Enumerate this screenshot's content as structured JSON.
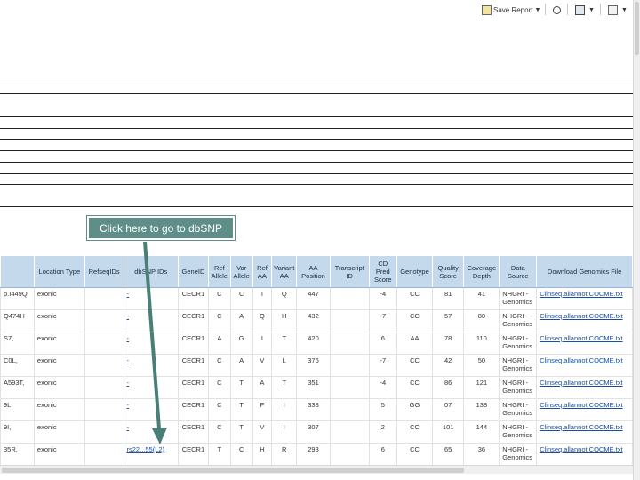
{
  "toolbar": {
    "save_report_label": "Save Report",
    "save_report_icon": "save-report-icon",
    "refresh_icon": "refresh-icon",
    "layout_icon": "layout-icon",
    "tools_icon": "tools-icon"
  },
  "callout": {
    "text": "Click here to go to dbSNP",
    "color": "#5f8e88"
  },
  "grid": {
    "header_color": "#c5d9ec",
    "link_color": "#1a4ea3",
    "columns": [
      "",
      "Location Type",
      "RefseqIDs",
      "dbSNP IDs",
      "GeneID",
      "Ref Allele",
      "Var Allele",
      "Ref AA",
      "Variant AA",
      "AA Position",
      "Transcript ID",
      "CD Pred Score",
      "Genotype",
      "Quality Score",
      "Coverage Depth",
      "Data Source",
      "Download Genomics File"
    ],
    "rows": [
      [
        "p.I449Q,",
        "exonic",
        "",
        "-",
        "CECR1",
        "C",
        "C",
        "I",
        "Q",
        "447",
        "",
        "-4",
        "CC",
        "81",
        "41",
        "NHGRI - Genomics",
        "Clinseq.allannot.COCME.txt"
      ],
      [
        "Q474H",
        "exonic",
        "",
        "-",
        "CECR1",
        "C",
        "A",
        "Q",
        "H",
        "432",
        "",
        "-7",
        "CC",
        "57",
        "80",
        "NHGRI - Genomics",
        "Clinseq.allannot.COCME.txt"
      ],
      [
        "S7,",
        "exonic",
        "",
        "-",
        "CECR1",
        "A",
        "G",
        "I",
        "T",
        "420",
        "",
        "6",
        "AA",
        "78",
        "110",
        "NHGRI - Genomics",
        "Clinseq.allannot.COCME.txt"
      ],
      [
        "C0L,",
        "exonic",
        "",
        "-",
        "CECR1",
        "C",
        "A",
        "V",
        "L",
        "376",
        "",
        "-7",
        "CC",
        "42",
        "50",
        "NHGRI - Genomics",
        "Clinseq.allannot.COCME.txt"
      ],
      [
        "A593T,",
        "exonic",
        "",
        "-",
        "CECR1",
        "C",
        "T",
        "A",
        "T",
        "351",
        "",
        "-4",
        "CC",
        "86",
        "121",
        "NHGRI - Genomics",
        "Clinseq.allannot.COCME.txt"
      ],
      [
        "9L,",
        "exonic",
        "",
        "-",
        "CECR1",
        "C",
        "T",
        "F",
        "I",
        "333",
        "",
        "5",
        "GG",
        "07",
        "138",
        "NHGRI - Genomics",
        "Clinseq.allannot.COCME.txt"
      ],
      [
        "9I,",
        "exonic",
        "",
        "-",
        "CECR1",
        "C",
        "T",
        "V",
        "I",
        "307",
        "",
        "2",
        "CC",
        "101",
        "144",
        "NHGRI - Genomics",
        "Clinseq.allannot.COCME.txt"
      ],
      [
        "35R,",
        "exonic",
        "",
        "rs22...55(L2)",
        "CECR1",
        "T",
        "C",
        "H",
        "R",
        "293",
        "",
        "6",
        "CC",
        "65",
        "36",
        "NHGRI - Genomics",
        "Clinseq.allannot.COCME.txt"
      ]
    ]
  }
}
